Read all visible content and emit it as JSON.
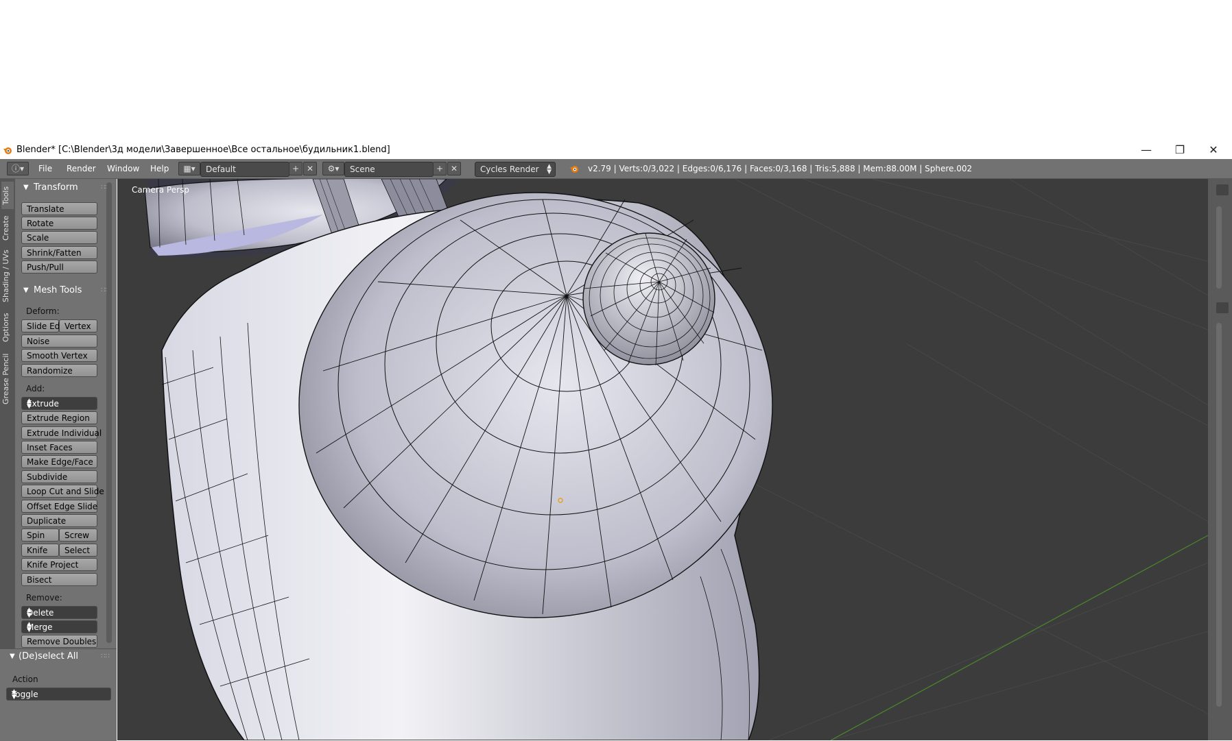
{
  "window": {
    "title": "Blender* [C:\\Blender\\3д модели\\Завершенное\\Все остальное\\будильник1.blend]",
    "minimize": "—",
    "restore": "❐",
    "close": "✕"
  },
  "menubar": {
    "items": [
      "File",
      "Render",
      "Window",
      "Help"
    ],
    "layout": "Default",
    "scene": "Scene",
    "engine": "Cycles Render",
    "status": "v2.79 | Verts:0/3,022 | Edges:0/6,176 | Faces:0/3,168 | Tris:5,888 | Mem:88.00M | Sphere.002"
  },
  "tabs": [
    "Tools",
    "Create",
    "Shading / UVs",
    "Options",
    "Grease Pencil"
  ],
  "transform": {
    "header": "Transform",
    "buttons": [
      "Translate",
      "Rotate",
      "Scale",
      "Shrink/Fatten",
      "Push/Pull"
    ]
  },
  "mesh_tools": {
    "header": "Mesh Tools",
    "deform_label": "Deform:",
    "slide_edge": "Slide Ed",
    "vertex": "Vertex",
    "noise": "Noise",
    "smooth_vertex": "Smooth Vertex",
    "randomize": "Randomize",
    "add_label": "Add:",
    "extrude": "Extrude",
    "extrude_region": "Extrude Region",
    "extrude_individual": "Extrude Individual",
    "inset_faces": "Inset Faces",
    "make_edge_face": "Make Edge/Face",
    "subdivide": "Subdivide",
    "loop_cut": "Loop Cut and Slide",
    "offset_edge": "Offset Edge Slide",
    "duplicate": "Duplicate",
    "spin": "Spin",
    "screw": "Screw",
    "knife": "Knife",
    "select": "Select",
    "knife_project": "Knife Project",
    "bisect": "Bisect",
    "remove_label": "Remove:",
    "delete": "Delete",
    "merge": "Merge",
    "remove_doubles": "Remove Doubles"
  },
  "operator": {
    "header": "(De)select All",
    "action_label": "Action",
    "action_value": "Toggle"
  },
  "viewport": {
    "label": "Camera Persp"
  },
  "colors": {
    "ui_panel": "#727272",
    "viewport_bg": "#3c3c3c",
    "mesh_surface": "#c8c8d6",
    "wire": "#111111",
    "grid_x_axis": "#4a8a2a"
  }
}
